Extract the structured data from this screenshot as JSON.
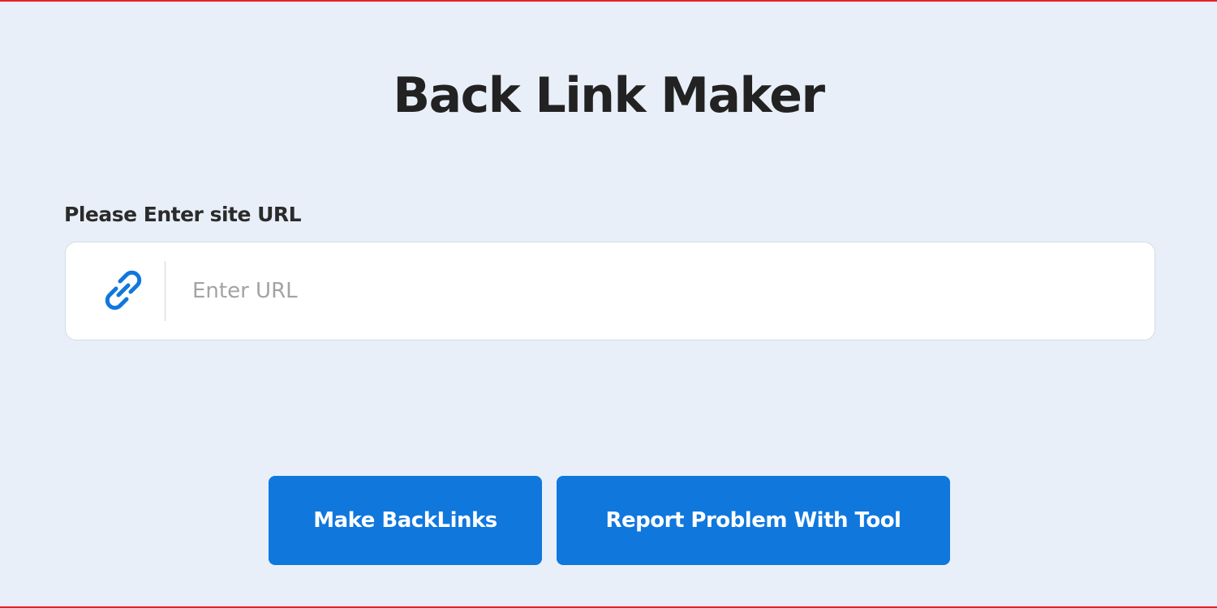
{
  "page": {
    "title": "Back Link Maker"
  },
  "form": {
    "label": "Please Enter site URL",
    "url_value": "",
    "url_placeholder": "Enter URL",
    "icon": "link-icon"
  },
  "actions": {
    "make_backlinks_label": "Make BackLinks",
    "report_problem_label": "Report Problem With Tool"
  },
  "colors": {
    "background": "#e9eff8",
    "frame_border": "#e8202a",
    "button": "#1077dd",
    "icon": "#1077dd",
    "title_text": "#222222"
  }
}
